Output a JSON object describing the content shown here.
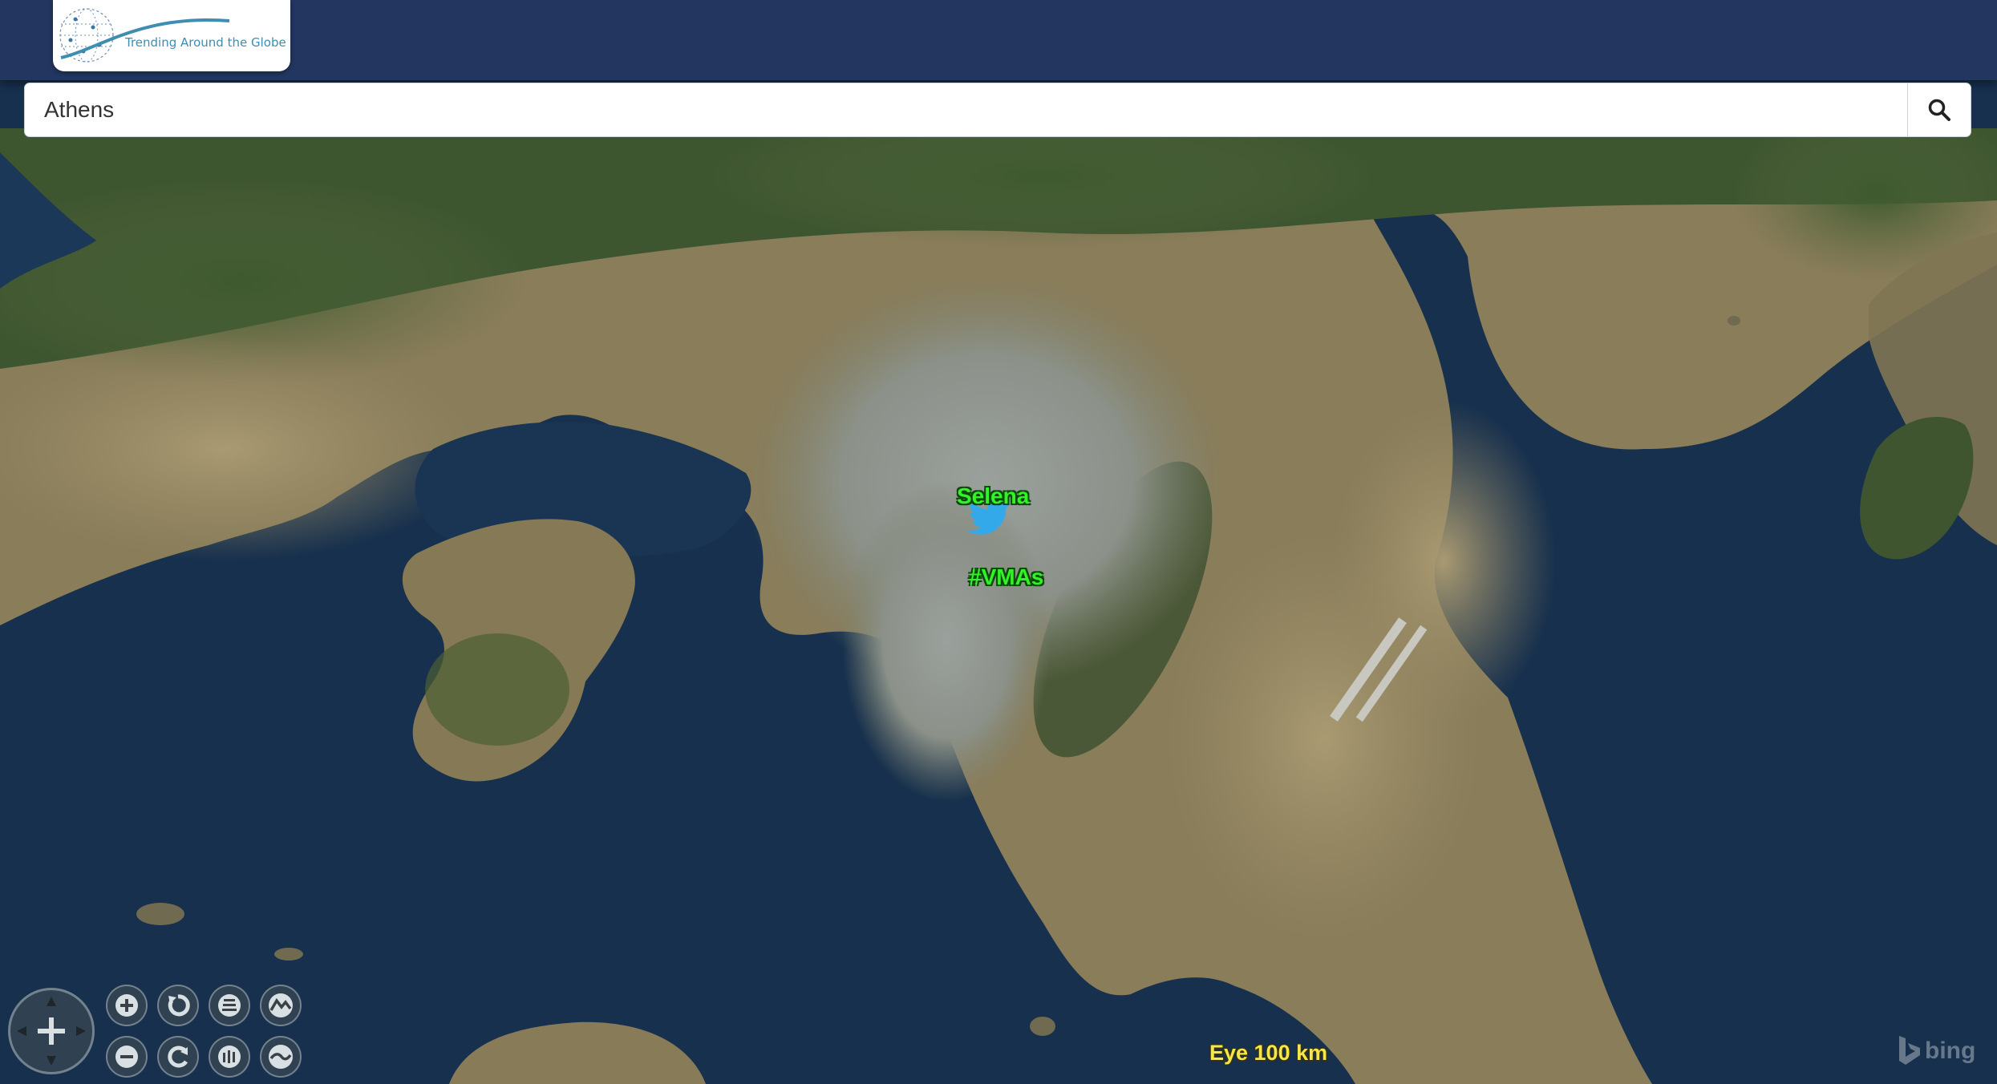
{
  "header": {
    "logo_text": "Trending Around the Globe",
    "bg_color": "#22365f"
  },
  "search": {
    "value": "Athens",
    "button_icon": "search-icon"
  },
  "map": {
    "imagery": "satellite",
    "location": "Athens",
    "markers": [
      {
        "label": "Selena",
        "icon": "twitter-bird-icon",
        "color": "#34f22a"
      },
      {
        "label": "#VMAs",
        "color": "#34f22a"
      }
    ],
    "eye_altitude": "Eye  100 km",
    "attribution": "bing"
  },
  "controls": [
    {
      "name": "pan-control",
      "icon": "pan-arrows-icon"
    },
    {
      "name": "zoom-in-button",
      "icon": "plus-icon"
    },
    {
      "name": "zoom-out-button",
      "icon": "minus-icon"
    },
    {
      "name": "rotate-left-button",
      "icon": "rotate-ccw-icon"
    },
    {
      "name": "rotate-right-button",
      "icon": "rotate-cw-icon"
    },
    {
      "name": "tilt-up-button",
      "icon": "tilt-up-icon"
    },
    {
      "name": "tilt-down-button",
      "icon": "tilt-down-icon"
    },
    {
      "name": "terrain-up-button",
      "icon": "terrain-up-icon"
    },
    {
      "name": "terrain-down-button",
      "icon": "terrain-down-icon"
    }
  ]
}
